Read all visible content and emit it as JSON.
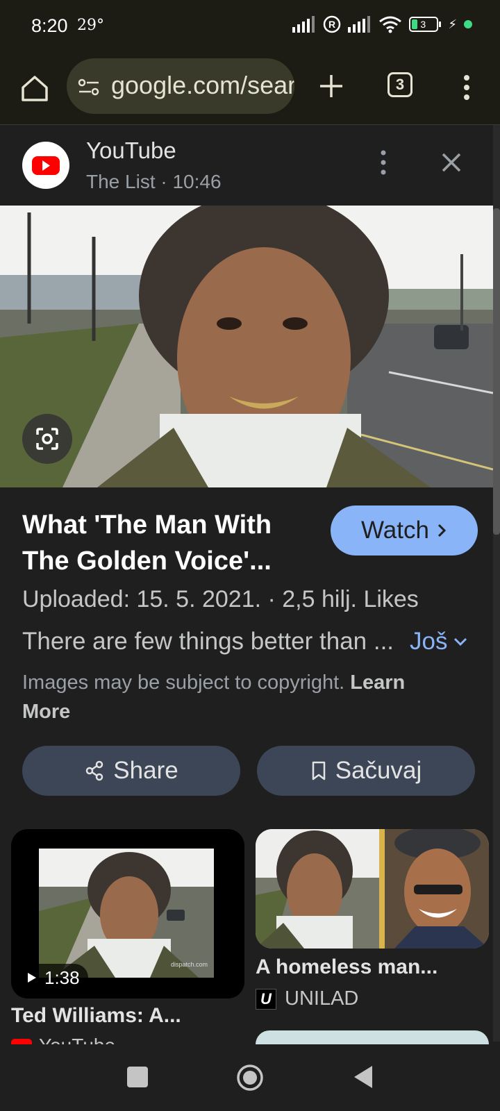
{
  "status_bar": {
    "time": "8:20",
    "temperature": "29°",
    "battery": "3"
  },
  "browser": {
    "url": "google.com/search",
    "tab_count": "3"
  },
  "card": {
    "source_name": "YouTube",
    "source_meta": "The List · 10:46",
    "title": "What 'The Man With The Golden Voice'...",
    "watch_label": "Watch",
    "uploaded": "Uploaded: 15. 5. 2021. · 2,5 hilj. Likes",
    "description": "There are few things better than ...",
    "more_label": "Još",
    "copyright_text": "Images may be subject to copyright.",
    "copyright_link": "Learn More",
    "share_label": "Share",
    "save_label": "Sačuvaj"
  },
  "results": [
    {
      "title": "Ted Williams: A...",
      "source": "YouTube",
      "duration": "1:38",
      "watermark": "dispatch.com"
    },
    {
      "title": "A homeless man...",
      "source": "UNILAD"
    }
  ],
  "colors": {
    "accent": "#8ab4f8",
    "background": "#1f1f1f",
    "toolbar": "#1c1b14",
    "button_bg": "#3c4656",
    "youtube_red": "#ff0000"
  }
}
